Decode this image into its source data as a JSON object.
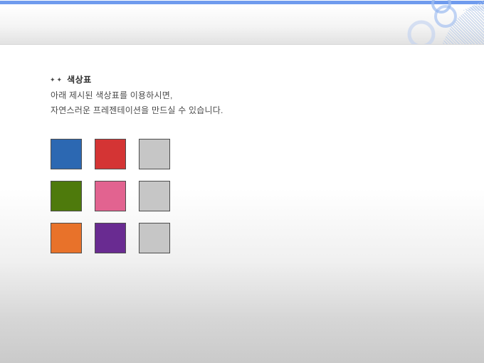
{
  "slide": {
    "title_bullet": "✦✦",
    "title": "색상표",
    "body_lines": [
      "아래 제시된 색상표를 이용하시면,",
      "자연스러운 프레젠테이션을 만드실 수 있습니다."
    ]
  },
  "palette": {
    "border_color": "#4d4d4d",
    "rows": [
      [
        {
          "name": "blue",
          "hex": "#2c68b2"
        },
        {
          "name": "red",
          "hex": "#d43434"
        },
        {
          "name": "gray-1",
          "hex": "#c6c6c6"
        }
      ],
      [
        {
          "name": "green",
          "hex": "#4e7a0c"
        },
        {
          "name": "pink",
          "hex": "#e26390"
        },
        {
          "name": "gray-2",
          "hex": "#c6c6c6"
        }
      ],
      [
        {
          "name": "orange",
          "hex": "#e8722a"
        },
        {
          "name": "purple",
          "hex": "#692b91"
        },
        {
          "name": "gray-3",
          "hex": "#c6c6c6"
        }
      ]
    ]
  },
  "theme": {
    "top_bar_blue": "#6f9bee",
    "header_gradient_end": "#e2e2e2",
    "page_bottom_gray": "#cacaca",
    "decor_ring_color": "#a9c3ee",
    "decor_stripe_color": "#b0c6e9"
  }
}
